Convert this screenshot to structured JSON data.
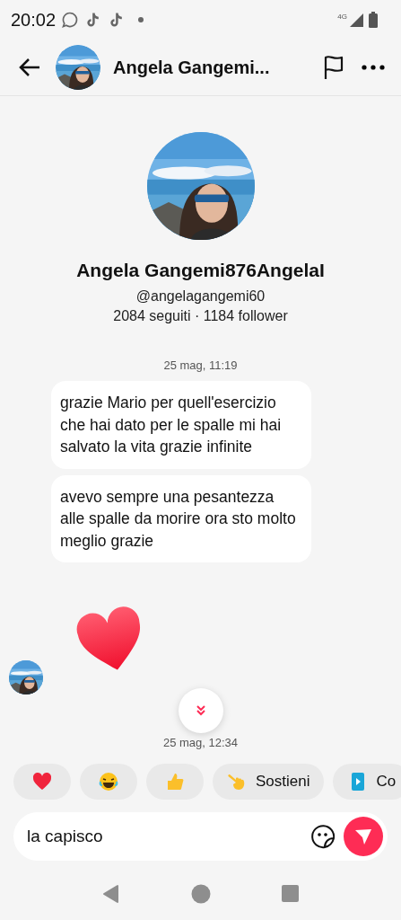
{
  "status_bar": {
    "time": "20:02",
    "network": "4G"
  },
  "header": {
    "title": "Angela Gangemi..."
  },
  "profile": {
    "name": "Angela Gangemi876AngelaI",
    "handle": "@angelagangemi60",
    "stats": "2084 seguiti · 1184 follower"
  },
  "messages": [
    {
      "kind": "time",
      "text": "25 mag, 11:19"
    },
    {
      "kind": "bubble",
      "text": "grazie Mario per quell'esercizio che hai dato per le spalle mi hai salvato la vita grazie infinite"
    },
    {
      "kind": "bubble",
      "text": "avevo sempre una pesantezza alle spalle da morire ora sto molto meglio grazie"
    },
    {
      "kind": "sticker"
    },
    {
      "kind": "time",
      "text": "25 mag, 12:34"
    }
  ],
  "quick_replies": [
    {
      "kind": "heart"
    },
    {
      "kind": "laugh"
    },
    {
      "kind": "thumb"
    },
    {
      "kind": "point",
      "label": "Sostieni"
    },
    {
      "kind": "play",
      "label": "Co"
    }
  ],
  "composer": {
    "value": "la capisco"
  }
}
